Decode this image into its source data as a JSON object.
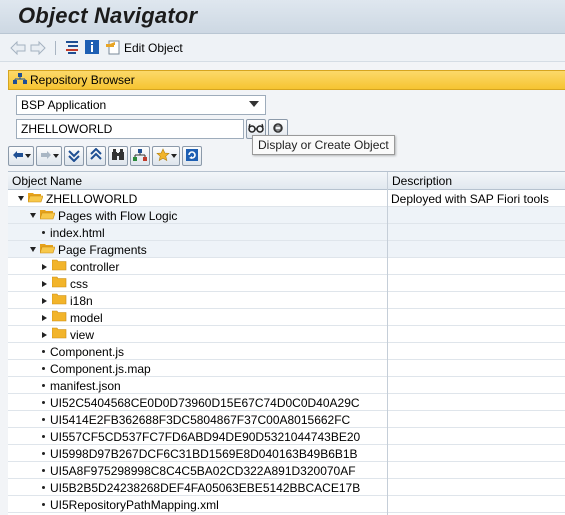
{
  "app": {
    "title": "Object Navigator"
  },
  "toolbar": {
    "edit_label": "Edit Object"
  },
  "repository": {
    "header": "Repository Browser",
    "object_type": "BSP Application",
    "object_name": "ZHELLOWORLD",
    "tooltip": "Display or Create Object"
  },
  "grid": {
    "col_name": "Object Name",
    "col_desc": "Description",
    "rows": [
      {
        "label": "ZHELLOWORLD",
        "desc": "Deployed with SAP Fiori tools"
      },
      {
        "label": "Pages with Flow Logic",
        "desc": ""
      },
      {
        "label": "index.html",
        "desc": ""
      },
      {
        "label": "Page Fragments",
        "desc": ""
      },
      {
        "label": "controller",
        "desc": ""
      },
      {
        "label": "css",
        "desc": ""
      },
      {
        "label": "i18n",
        "desc": ""
      },
      {
        "label": "model",
        "desc": ""
      },
      {
        "label": "view",
        "desc": ""
      },
      {
        "label": "Component.js",
        "desc": ""
      },
      {
        "label": "Component.js.map",
        "desc": ""
      },
      {
        "label": "manifest.json",
        "desc": ""
      },
      {
        "label": "UI52C5404568CE0D0D73960D15E67C74D0C0D40A29C",
        "desc": ""
      },
      {
        "label": "UI5414E2FB362688F3DC5804867F37C00A8015662FC",
        "desc": ""
      },
      {
        "label": "UI557CF5CD537FC7FD6ABD94DE90D5321044743BE20",
        "desc": ""
      },
      {
        "label": "UI5998D97B267DCF6C31BD1569E8D040163B49B6B1B",
        "desc": ""
      },
      {
        "label": "UI5A8F975298998C8C4C5BA02CD322A891D320070AF",
        "desc": ""
      },
      {
        "label": "UI5B2B5D24238268DEF4FA05063EBE5142BBCACE17B",
        "desc": ""
      },
      {
        "label": "UI5RepositoryPathMapping.xml",
        "desc": ""
      }
    ]
  },
  "colors": {
    "header_yellow": "#f6c431",
    "folder": "#f2b42a",
    "title_bg": "#cdd8e3"
  }
}
